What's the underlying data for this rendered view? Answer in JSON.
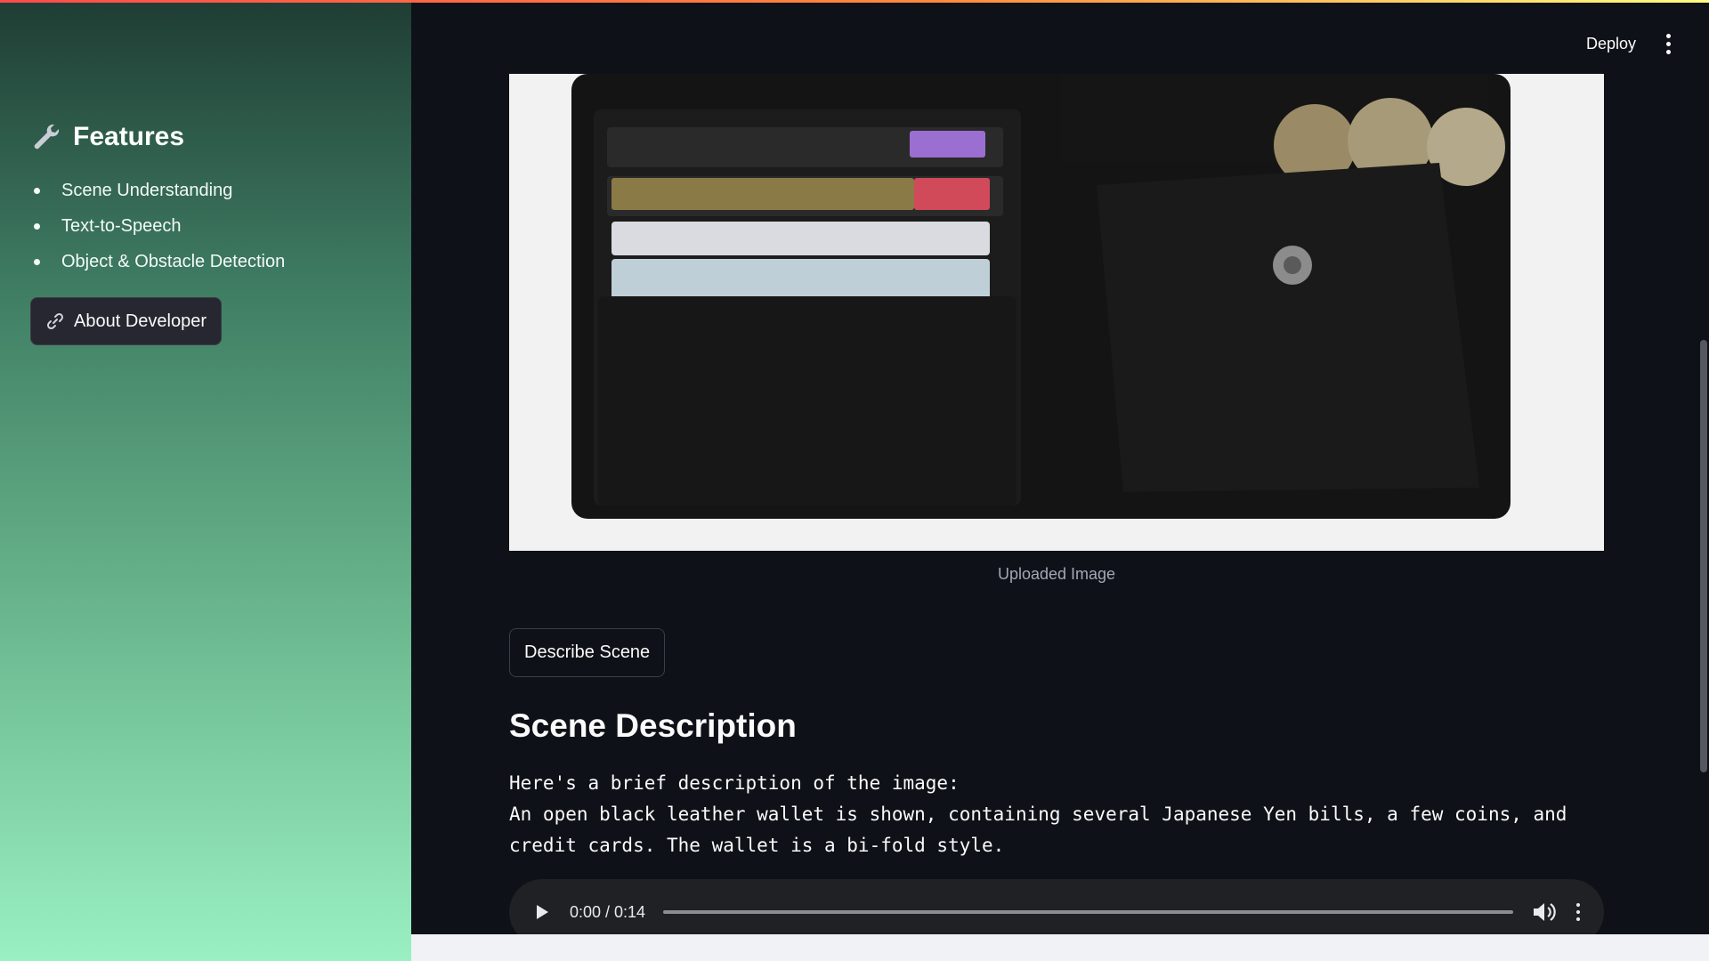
{
  "header": {
    "deploy_label": "Deploy"
  },
  "sidebar": {
    "title": "Features",
    "title_icon": "wrench-icon",
    "features": [
      "Scene Understanding",
      "Text-to-Speech",
      "Object & Obstacle Detection"
    ],
    "about_button_label": "About Developer",
    "about_button_icon": "link-icon"
  },
  "main": {
    "image_caption": "Uploaded Image",
    "describe_button_label": "Describe Scene",
    "section_title": "Scene Description",
    "description_intro": "Here's a brief description of the image:",
    "description_body": "An open black leather wallet is shown, containing several Japanese Yen bills, a few coins, and credit cards. The wallet is a bi-fold style."
  },
  "audio_player": {
    "time_display": "0:00 / 0:14",
    "progress": 0
  },
  "colors": {
    "app_background": "#0e1117",
    "sidebar_gradient_top": "#1f3d34",
    "sidebar_gradient_bottom": "#9af0c2",
    "button_background": "#262730",
    "audio_player_background": "#202124"
  }
}
